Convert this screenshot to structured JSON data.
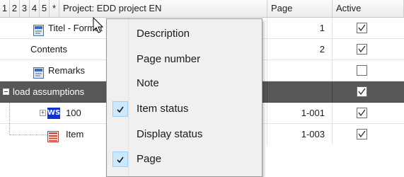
{
  "header": {
    "levels": [
      "1",
      "2",
      "3",
      "4",
      "5",
      "*"
    ],
    "project_title": "Project: EDD project EN",
    "page_col": "Page",
    "active_col": "Active"
  },
  "rows": [
    {
      "title": "Titel - Format",
      "page": "1",
      "active": true
    },
    {
      "title": "Contents",
      "page": "2",
      "active": true
    },
    {
      "title": "Remarks",
      "page": "",
      "active": false
    },
    {
      "title": "load assumptions",
      "page": "",
      "active": true
    },
    {
      "badge": "WS",
      "title": "100",
      "page": "1-001",
      "active": true
    },
    {
      "title": "Item",
      "page": "1-003",
      "active": true
    }
  ],
  "context_menu": {
    "items": [
      {
        "label": "Description",
        "checked": false
      },
      {
        "label": "Page number",
        "checked": false
      },
      {
        "label": "Note",
        "checked": false
      },
      {
        "label": "Item status",
        "checked": true
      },
      {
        "label": "Display status",
        "checked": false
      },
      {
        "label": "Page",
        "checked": true
      }
    ]
  }
}
